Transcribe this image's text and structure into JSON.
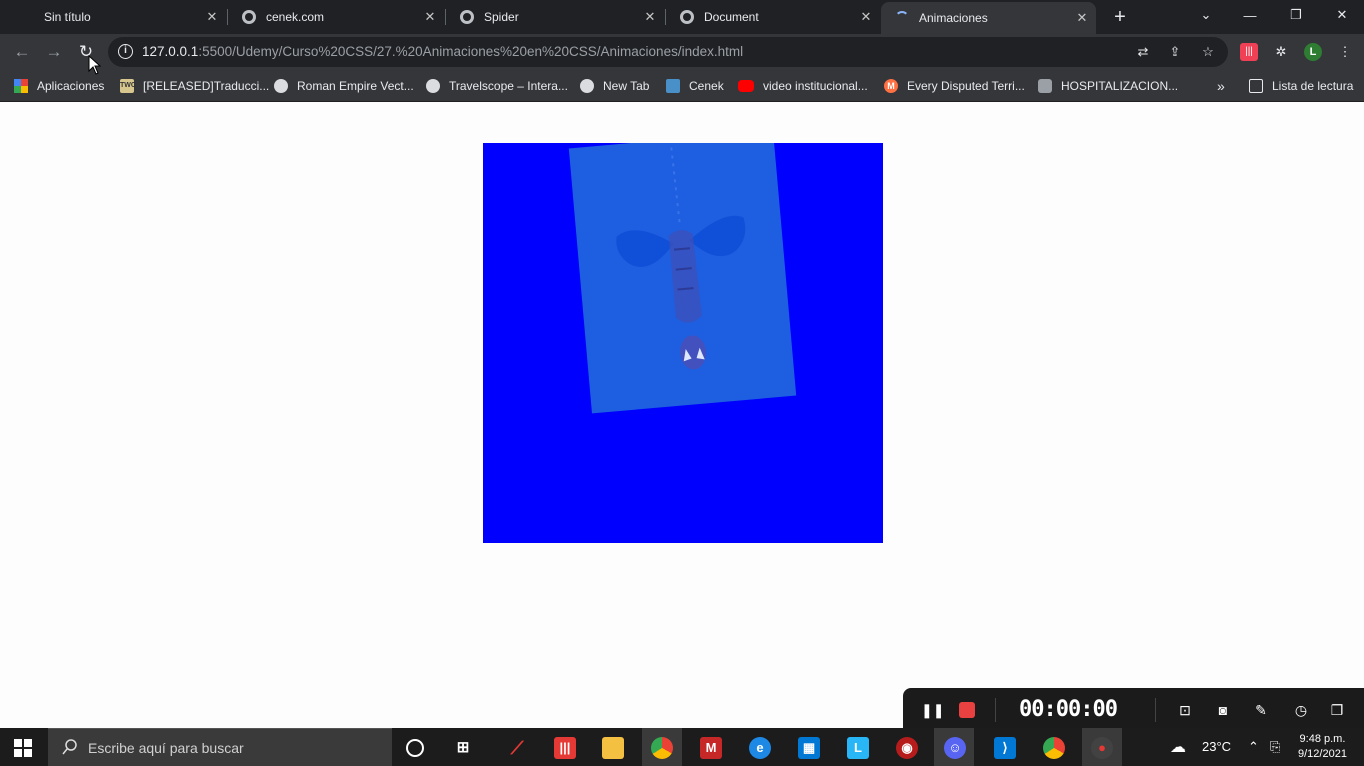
{
  "tabs": [
    {
      "title": "Sin título",
      "icon": "blank-icon",
      "active": false
    },
    {
      "title": "cenek.com",
      "icon": "globe-icon",
      "active": false
    },
    {
      "title": "Spider",
      "icon": "globe-icon",
      "active": false
    },
    {
      "title": "Document",
      "icon": "globe-icon",
      "active": false
    },
    {
      "title": "Animaciones",
      "icon": "loading-icon",
      "active": true
    }
  ],
  "address_bar": {
    "host": "127.0.0.1",
    "path": ":5500/Udemy/Curso%20CSS/27.%20Animaciones%20en%20CSS/Animaciones/index.html"
  },
  "profile_initial": "L",
  "pocket_label": "|||",
  "bookmarks": [
    {
      "label": "Aplicaciones",
      "icon": "apps-grid-icon"
    },
    {
      "label": "[RELEASED]Traducci...",
      "icon": "twc-icon",
      "badge": "TWC"
    },
    {
      "label": "Roman Empire Vect...",
      "icon": "globe-icon"
    },
    {
      "label": "Travelscope – Intera...",
      "icon": "globe-icon"
    },
    {
      "label": "New Tab",
      "icon": "globe-icon"
    },
    {
      "label": "Cenek",
      "icon": "cenek-icon"
    },
    {
      "label": "video institucional...",
      "icon": "youtube-icon"
    },
    {
      "label": "Every Disputed Terri...",
      "icon": "m-icon",
      "badge": "M"
    },
    {
      "label": "HOSPITALIZACION...",
      "icon": "hospital-icon"
    }
  ],
  "bookmarks_overflow": "»",
  "reading_list": "Lista de lectura",
  "page": {
    "box_color": "#0000ff",
    "card_color": "#1d5fe0",
    "image_subject": "spider-man-hanging-upside-down"
  },
  "recorder": {
    "timer": "00:00:00"
  },
  "taskbar": {
    "search_placeholder": "Escribe aquí para buscar",
    "weather": "23°C",
    "time": "9:48 p.m.",
    "date": "9/12/2021"
  }
}
